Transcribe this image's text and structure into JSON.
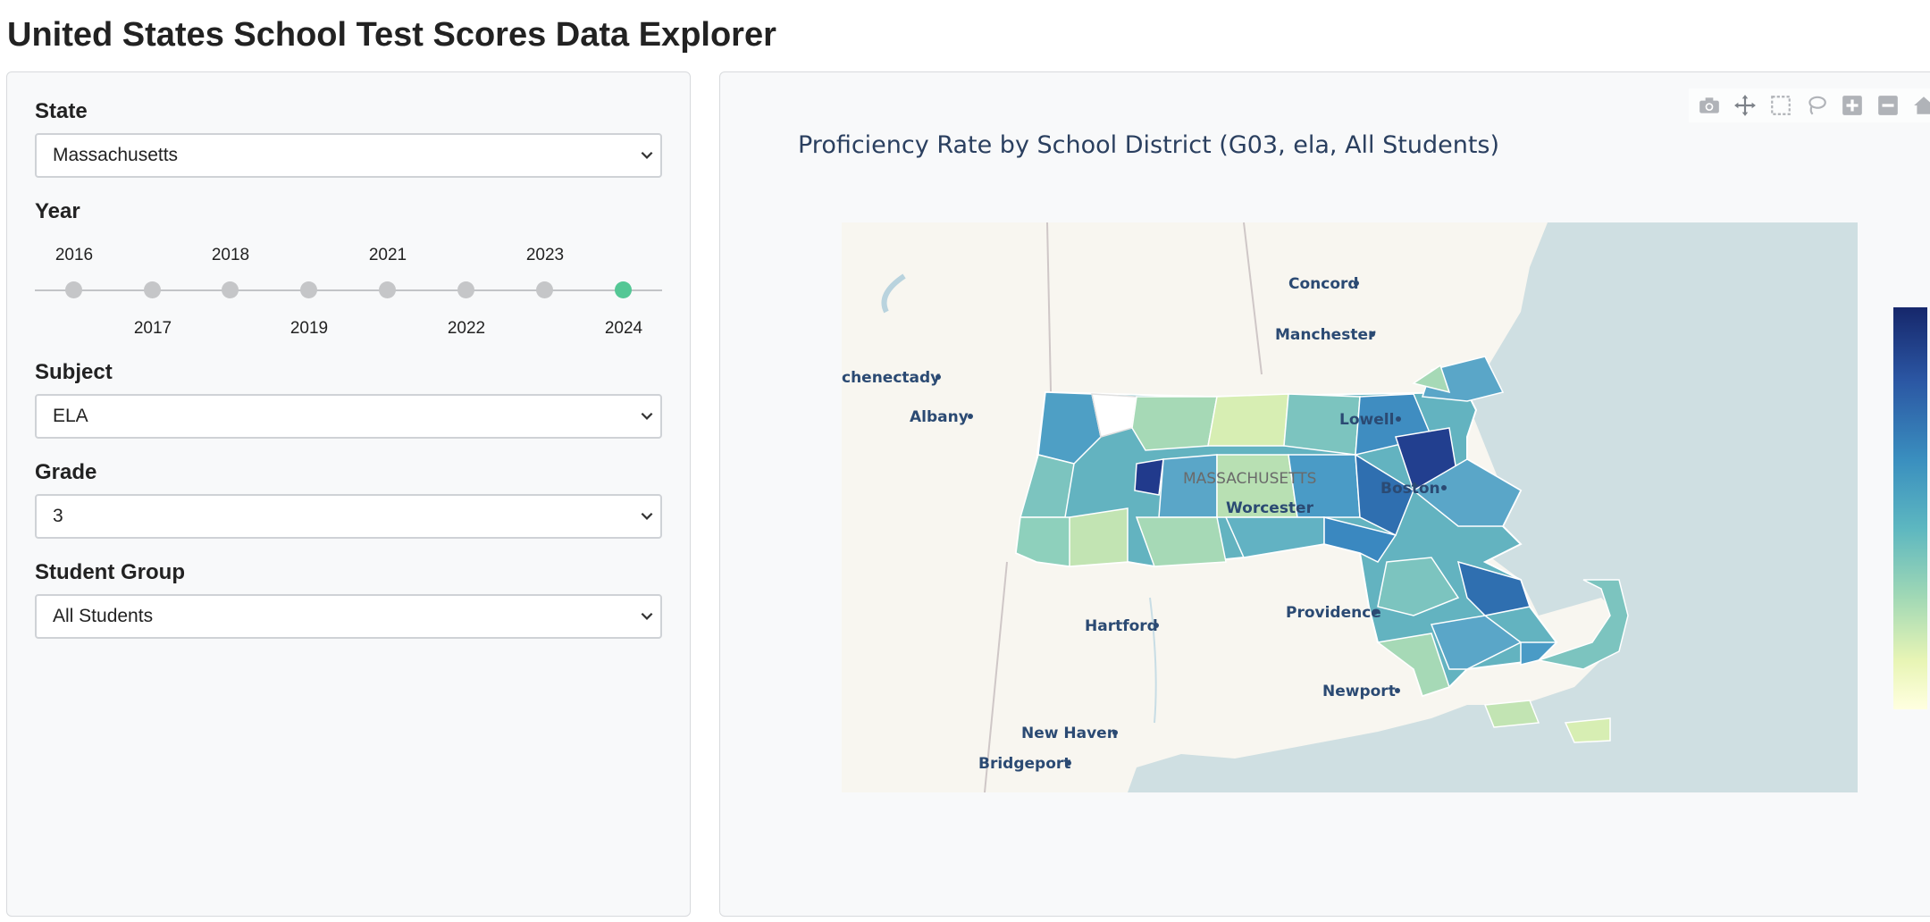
{
  "app": {
    "title": "United States School Test Scores Data Explorer"
  },
  "controls": {
    "state": {
      "label": "State",
      "value": "Massachusetts"
    },
    "year": {
      "label": "Year",
      "marks": [
        "2016",
        "2017",
        "2018",
        "2019",
        "2021",
        "2022",
        "2023",
        "2024"
      ],
      "selected": "2024",
      "selected_index": 7
    },
    "subject": {
      "label": "Subject",
      "value": "ELA"
    },
    "grade": {
      "label": "Grade",
      "value": "3"
    },
    "group": {
      "label": "Student Group",
      "value": "All Students"
    }
  },
  "chart": {
    "title": "Proficiency Rate by School District (G03, ela, All Students)",
    "map_labels": [
      "Concord",
      "Manchester",
      "chenectady",
      "Albany",
      "Lowell",
      "MASSACHUSETTS",
      "Boston",
      "Worcester",
      "Providence",
      "Hartford",
      "Newport",
      "New Haven",
      "Bridgeport"
    ],
    "colorscale": [
      "#ffffe0",
      "#e8f5b5",
      "#a0d8b5",
      "#5db7c0",
      "#3a8fbf",
      "#2b56a3",
      "#16276b"
    ]
  },
  "modebar": [
    "camera-icon",
    "pan-icon",
    "box-select-icon",
    "lasso-icon",
    "zoom-in-icon",
    "zoom-out-icon",
    "home-icon"
  ]
}
